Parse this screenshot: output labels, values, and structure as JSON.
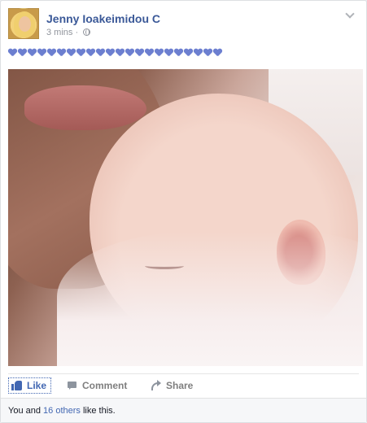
{
  "post": {
    "author_name": "Jenny Ioakeimidou C",
    "time": "3 mins",
    "separator": "·",
    "privacy_icon": "globe-icon",
    "menu_icon": "chevron-down-icon",
    "emoji_count": 22,
    "emoji_icon": "blue-heart-icon",
    "photo_description_icon": "photo"
  },
  "actions": {
    "like_label": "Like",
    "comment_label": "Comment",
    "share_label": "Share"
  },
  "likes": {
    "prefix": "You and ",
    "others_link": "16 others",
    "suffix": " like this."
  },
  "colors": {
    "link": "#3b5998",
    "action_active": "#4267b2",
    "muted": "#90949c"
  }
}
